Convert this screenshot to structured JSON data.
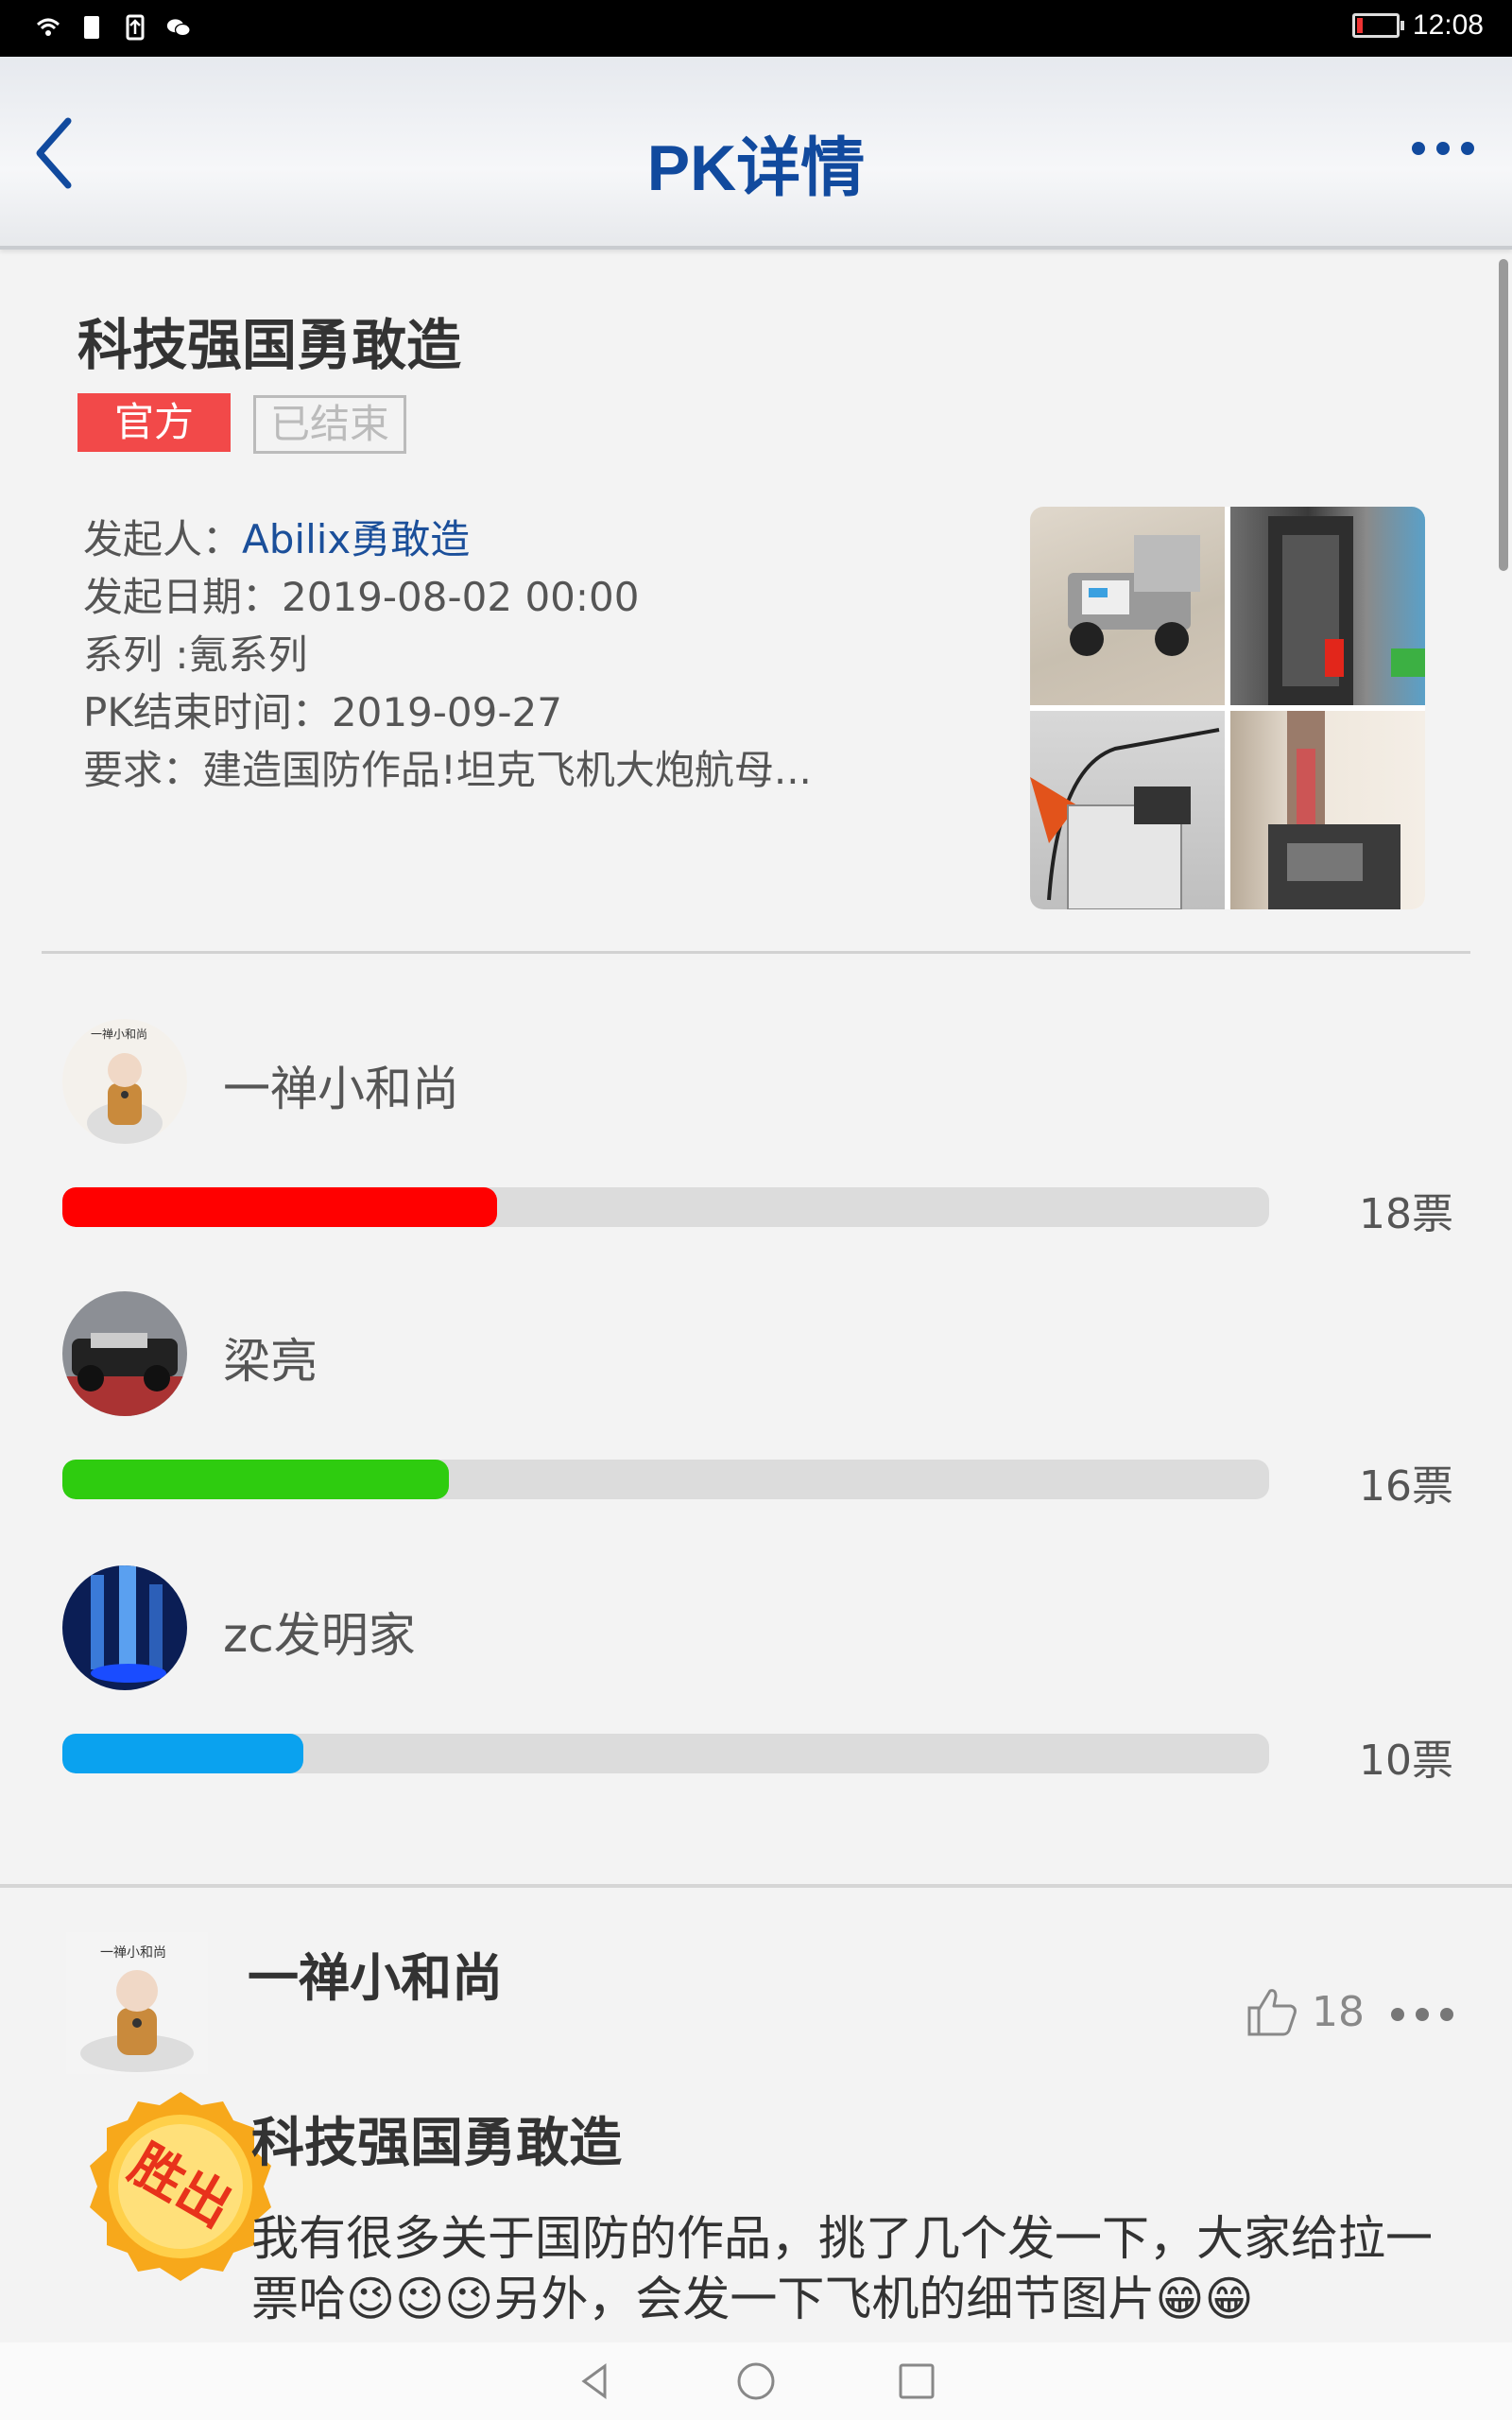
{
  "status_bar": {
    "time": "12:08",
    "icons": [
      "wifi-icon",
      "sim-icon",
      "upload-icon",
      "wechat-icon"
    ],
    "battery_color": "#e33333"
  },
  "header": {
    "title": "PK详情",
    "back_icon": "chevron-left-icon",
    "more_icon": "more-dots-icon",
    "accent": "#114a9e"
  },
  "pk": {
    "title": "科技强国勇敢造",
    "tag_official": "官方",
    "tag_status": "已结束",
    "creator_label": "发起人：",
    "creator": "Abilix勇敢造",
    "date_label": "发起日期：",
    "date": "2019-08-02 00:00",
    "series": "系列 :氪系列",
    "end_label": "PK结束时间：",
    "end": "2019-09-27",
    "requirement": "要求：建造国防作品!坦克飞机大炮航母..."
  },
  "candidates": [
    {
      "name": "一禅小和尚",
      "votes": "18票",
      "vote_count": 18,
      "fill_fraction": 0.36,
      "color": "#ff0000"
    },
    {
      "name": "梁亮",
      "votes": "16票",
      "vote_count": 16,
      "fill_fraction": 0.32,
      "color": "#2ecc0f"
    },
    {
      "name": "zc发明家",
      "votes": "10票",
      "vote_count": 10,
      "fill_fraction": 0.2,
      "color": "#0aa2ef"
    }
  ],
  "post": {
    "author": "一禅小和尚",
    "likes": "18",
    "badge": "胜出",
    "title": "科技强国勇敢造",
    "body": "我有很多关于国防的作品，挑了几个发一下，大家给拉一票哈😉😉😉另外，会发一下飞机的细节图片😁😁"
  }
}
